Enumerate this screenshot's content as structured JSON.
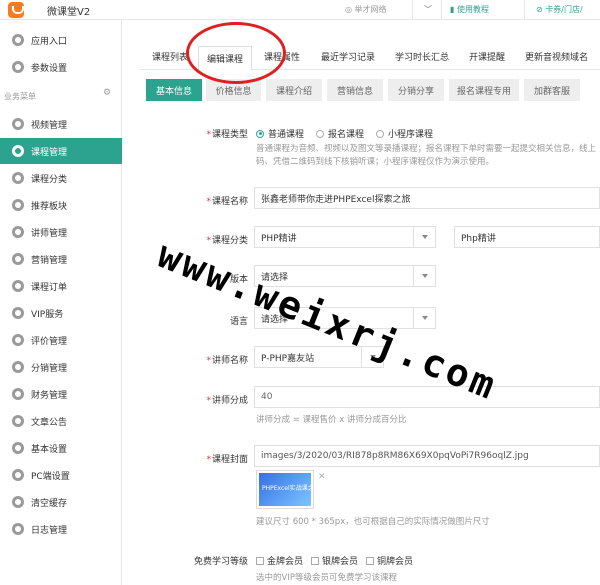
{
  "header": {
    "app_title": "微课堂V2",
    "items": [
      "举才网络",
      "使用教程",
      "卡券/门店/"
    ]
  },
  "sidebar": {
    "top_items": [
      {
        "label": "应用入口",
        "icon": "chat-icon"
      },
      {
        "label": "参数设置",
        "icon": "gear-icon"
      }
    ],
    "group_label": "业务菜单",
    "items": [
      {
        "label": "视频管理",
        "icon": "gear-icon"
      },
      {
        "label": "课程管理",
        "icon": "gear-icon",
        "active": true
      },
      {
        "label": "课程分类",
        "icon": "gear-icon"
      },
      {
        "label": "推荐板块",
        "icon": "gear-icon"
      },
      {
        "label": "讲师管理",
        "icon": "gear-icon"
      },
      {
        "label": "营销管理",
        "icon": "gear-icon"
      },
      {
        "label": "课程订单",
        "icon": "gear-icon"
      },
      {
        "label": "VIP服务",
        "icon": "gear-icon"
      },
      {
        "label": "评价管理",
        "icon": "gear-icon"
      },
      {
        "label": "分销管理",
        "icon": "gear-icon"
      },
      {
        "label": "财务管理",
        "icon": "gear-icon"
      },
      {
        "label": "文章公告",
        "icon": "gear-icon"
      },
      {
        "label": "基本设置",
        "icon": "gear-icon"
      },
      {
        "label": "PC端设置",
        "icon": "gear-icon"
      },
      {
        "label": "清空缓存",
        "icon": "gear-icon"
      },
      {
        "label": "日志管理",
        "icon": "gear-icon"
      }
    ]
  },
  "tabs": [
    "课程列表",
    "编辑课程",
    "课程属性",
    "最近学习记录",
    "学习时长汇总",
    "开课提醒",
    "更新音视频域名"
  ],
  "subtabs": [
    "基本信息",
    "价格信息",
    "课程介绍",
    "营销信息",
    "分销分享",
    "报名课程专用",
    "加群客服"
  ],
  "form": {
    "course_type": {
      "label": "课程类型",
      "options": [
        "普通课程",
        "报名课程",
        "小程序课程"
      ],
      "hint_line1": "普通课程为音频、视频以及图文等录播课程；报名课程下单时需要一起提交相关信息，线上",
      "hint_line2": "码、凭借二维码到线下核销听课；小程序课程仅作为演示使用。"
    },
    "course_name": {
      "label": "课程名称",
      "value": "张鑫老师带你走进PHPExcel探索之旅"
    },
    "course_category": {
      "label": "课程分类",
      "value1": "PHP精讲",
      "value2": "Php精讲"
    },
    "version": {
      "label": "版本",
      "value": "请选择"
    },
    "language": {
      "label": "语言",
      "value": "请选择"
    },
    "teacher": {
      "label": "讲师名称",
      "value": "P-PHP嘉友站"
    },
    "teacher_share": {
      "label": "讲师分成",
      "value": "40",
      "hint": "讲师分成 = 课程售价 x 讲师分成百分比"
    },
    "cover": {
      "label": "课程封面",
      "path": "images/3/2020/03/RI878p8RM86X69X0pqVoPi7R96oqlZ.jpg",
      "thumb_text": "PHPExcel实战课之旅",
      "hint": "建议尺寸 600 * 365px，也可根据自己的实际情况做图片尺寸"
    },
    "free_level": {
      "label": "免费学习等级",
      "options": [
        "金牌会员",
        "银牌会员",
        "铜牌会员"
      ],
      "hint": "选中的VIP等级会员可免费学习该课程"
    }
  },
  "watermark": "www.weixrj.com"
}
